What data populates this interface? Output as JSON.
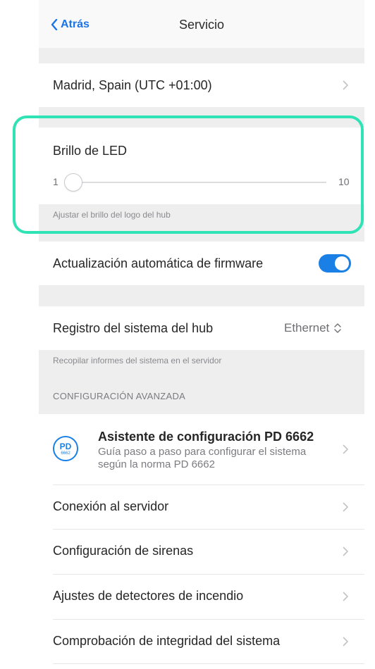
{
  "header": {
    "back_label": "Atrás",
    "title": "Servicio"
  },
  "timezone": {
    "label": "Madrid, Spain (UTC +01:00)"
  },
  "led": {
    "label": "Brillo de LED",
    "min": "1",
    "max": "10",
    "value": 1,
    "caption": "Ajustar el brillo del logo del hub"
  },
  "firmware": {
    "label": "Actualización automática de firmware",
    "enabled": true
  },
  "hub_log": {
    "label": "Registro del sistema del hub",
    "value": "Ethernet",
    "caption": "Recopilar informes del sistema en el servidor"
  },
  "advanced": {
    "section_title": "CONFIGURACIÓN AVANZADA",
    "wizard": {
      "icon_top": "PD",
      "icon_bottom": "6662",
      "title": "Asistente de configuración PD 6662",
      "description": "Guía paso a paso para configurar el sistema según la norma PD 6662"
    },
    "items": [
      {
        "label": "Conexión al servidor"
      },
      {
        "label": "Configuración de sirenas"
      },
      {
        "label": "Ajustes de detectores de incendio"
      },
      {
        "label": "Comprobación de integridad del sistema"
      }
    ]
  },
  "colors": {
    "accent": "#1a80e5",
    "highlight": "#2fe3b5",
    "background": "#eeeeef"
  }
}
